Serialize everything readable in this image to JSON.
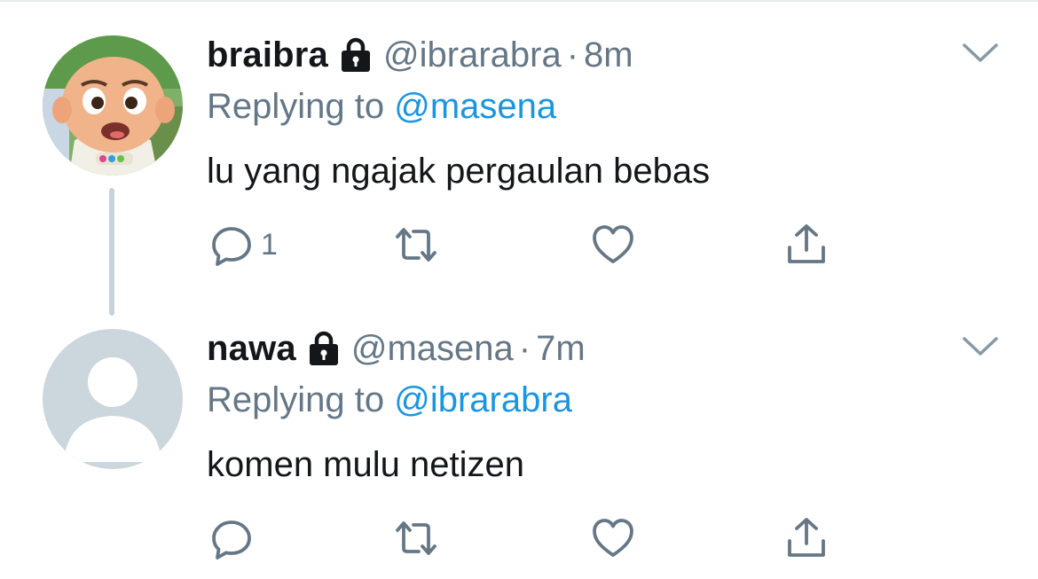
{
  "tweets": [
    {
      "display_name": "braibra",
      "handle": "@ibrarabra",
      "separator": "·",
      "time": "8m",
      "replying_prefix": "Replying to",
      "replying_to": "@masena",
      "text": "lu yang ngajak pergaulan bebas",
      "reply_count": "1",
      "avatar": "cartoon-character-avatar",
      "protected": true
    },
    {
      "display_name": "nawa",
      "handle": "@masena",
      "separator": "·",
      "time": "7m",
      "replying_prefix": "Replying to",
      "replying_to": "@ibrarabra",
      "text": "komen mulu netizen",
      "reply_count": "",
      "avatar": "default-avatar",
      "protected": true
    }
  ],
  "colors": {
    "name": "#14171a",
    "secondary": "#657786",
    "link": "#1b95e0",
    "icon": "#657786",
    "thread_line": "#c8d2da",
    "default_avatar_bg": "#ccd6dd"
  },
  "icons": [
    "lock-icon",
    "chevron-down-icon",
    "reply-icon",
    "retweet-icon",
    "like-icon",
    "share-icon"
  ]
}
